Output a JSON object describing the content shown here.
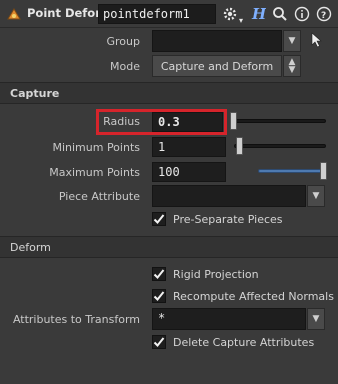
{
  "header": {
    "node_type": "Point Deform",
    "node_name": "pointdeform1",
    "icons": [
      "node-type-icon",
      "gear-icon",
      "help-h-icon",
      "search-icon",
      "info-icon",
      "help-icon"
    ]
  },
  "group": {
    "label": "Group",
    "value": ""
  },
  "mode": {
    "label": "Mode",
    "value": "Capture and Deform"
  },
  "capture": {
    "section_title": "Capture",
    "radius": {
      "label": "Radius",
      "value": "0.3",
      "fill": 0.0
    },
    "minimum_points": {
      "label": "Minimum Points",
      "value": "1",
      "fill": 0.02
    },
    "maximum_points": {
      "label": "Maximum Points",
      "value": "100",
      "fill": 1.0
    },
    "piece_attribute": {
      "label": "Piece Attribute",
      "value": ""
    },
    "pre_separate": {
      "label": "Pre-Separate Pieces",
      "checked": true
    }
  },
  "deform": {
    "section_title": "Deform",
    "rigid_projection": {
      "label": "Rigid Projection",
      "checked": true
    },
    "recompute_normals": {
      "label": "Recompute Affected Normals",
      "checked": true
    },
    "attributes_to_transform": {
      "label": "Attributes to Transform",
      "value": "*"
    },
    "delete_capture": {
      "label": "Delete Capture Attributes",
      "checked": true
    }
  },
  "colors": {
    "highlight": "#d6242b",
    "slider_fill": "#4e7ab0",
    "background": "#3a3a3a"
  }
}
